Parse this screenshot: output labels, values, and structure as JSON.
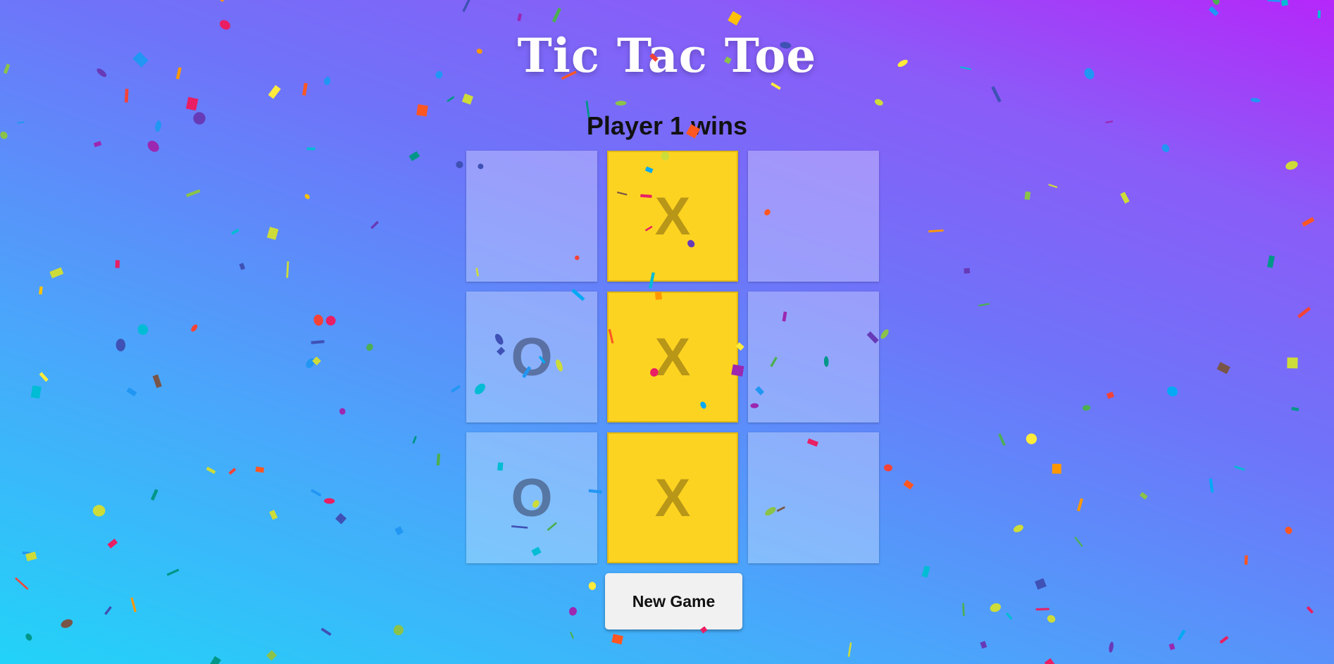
{
  "game": {
    "title": "Tic Tac Toe",
    "status": "Player 1 wins",
    "board": [
      [
        "",
        "X",
        ""
      ],
      [
        "O",
        "X",
        ""
      ],
      [
        "O",
        "X",
        ""
      ]
    ],
    "winning_cells": [
      [
        0,
        1
      ],
      [
        1,
        1
      ],
      [
        2,
        1
      ]
    ],
    "new_game_label": "New Game"
  },
  "colors": {
    "background_gradient": [
      "#22d3f8",
      "#4aa6fb",
      "#6f73f9",
      "#8a5cf8",
      "#b527f9"
    ],
    "winning_cell": "#fdd322",
    "empty_cell": "rgba(255,255,255,0.30)",
    "x_mark_win": "#b89617",
    "o_mark": "#5e6f92",
    "confetti": [
      "#f44336",
      "#e91e63",
      "#9c27b0",
      "#673ab7",
      "#3f51b5",
      "#2196f3",
      "#03a9f4",
      "#00bcd4",
      "#009688",
      "#4caf50",
      "#8bc34a",
      "#cddc39",
      "#ffeb3b",
      "#ffc107",
      "#ff9800",
      "#ff5722",
      "#795548"
    ]
  },
  "icons": {
    "confetti": "confetti-particles"
  }
}
